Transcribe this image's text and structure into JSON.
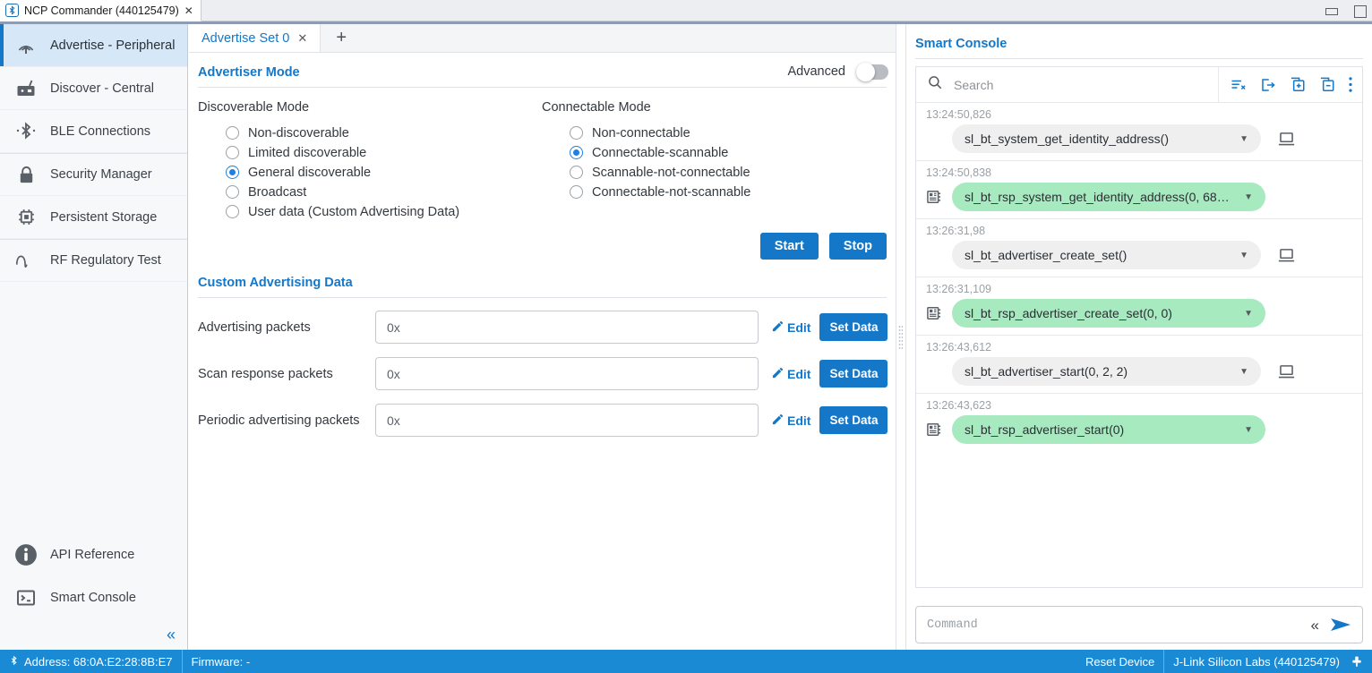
{
  "window": {
    "tab_title": "NCP Commander (440125479)",
    "app_icon": "bluetooth-icon",
    "tab_close_icon": "close-icon",
    "minimize_icon": "minimize-icon",
    "maximize_icon": "maximize-icon"
  },
  "sidebar": {
    "items": [
      {
        "label": "Advertise - Peripheral",
        "icon": "advertise-icon",
        "active": true
      },
      {
        "label": "Discover - Central",
        "icon": "radio-icon",
        "active": false
      },
      {
        "label": "BLE Connections",
        "icon": "bluetooth-connections-icon",
        "active": false
      },
      {
        "label": "Security Manager",
        "icon": "lock-icon",
        "active": false
      },
      {
        "label": "Persistent Storage",
        "icon": "chip-icon",
        "active": false
      },
      {
        "label": "RF Regulatory Test",
        "icon": "waveform-icon",
        "active": false
      }
    ],
    "bottom_items": [
      {
        "label": "API Reference",
        "icon": "info-icon"
      },
      {
        "label": "Smart Console",
        "icon": "terminal-icon"
      }
    ],
    "collapse_icon": "chevron-double-left-icon"
  },
  "center": {
    "tabs": [
      {
        "label": "Advertise Set 0",
        "close_icon": "close-icon",
        "active": true
      }
    ],
    "add_tab_icon": "plus-icon",
    "advertiser_mode": {
      "title": "Advertiser Mode",
      "advanced_label": "Advanced",
      "advanced_on": false,
      "discoverable": {
        "heading": "Discoverable Mode",
        "options": [
          {
            "label": "Non-discoverable",
            "selected": false
          },
          {
            "label": "Limited discoverable",
            "selected": false
          },
          {
            "label": "General discoverable",
            "selected": true
          },
          {
            "label": "Broadcast",
            "selected": false
          },
          {
            "label": "User data (Custom Advertising Data)",
            "selected": false
          }
        ]
      },
      "connectable": {
        "heading": "Connectable Mode",
        "options": [
          {
            "label": "Non-connectable",
            "selected": false
          },
          {
            "label": "Connectable-scannable",
            "selected": true
          },
          {
            "label": "Scannable-not-connectable",
            "selected": false
          },
          {
            "label": "Connectable-not-scannable",
            "selected": false
          }
        ]
      },
      "start_label": "Start",
      "stop_label": "Stop"
    },
    "custom_advertising_data": {
      "title": "Custom Advertising Data",
      "edit_label": "Edit",
      "edit_icon": "pencil-icon",
      "set_data_label": "Set Data",
      "rows": [
        {
          "label": "Advertising packets",
          "value": "0x"
        },
        {
          "label": "Scan response packets",
          "value": "0x"
        },
        {
          "label": "Periodic advertising packets",
          "value": "0x"
        }
      ]
    }
  },
  "smart_console": {
    "title": "Smart Console",
    "search_placeholder": "Search",
    "search_value": "",
    "search_icon": "search-icon",
    "tools": [
      {
        "name": "clear-list-icon"
      },
      {
        "name": "export-icon"
      },
      {
        "name": "expand-all-icon"
      },
      {
        "name": "collapse-all-icon"
      },
      {
        "name": "more-options-icon"
      }
    ],
    "entries": [
      {
        "time": "13:24:50,826",
        "text": "sl_bt_system_get_identity_address()",
        "kind": "request",
        "side_icon": "",
        "trailing_icon": "pc-icon"
      },
      {
        "time": "13:24:50,838",
        "text": "sl_bt_rsp_system_get_identity_address(0, 68:0A:...",
        "kind": "response",
        "side_icon": "chip-icon",
        "trailing_icon": ""
      },
      {
        "time": "13:26:31,98",
        "text": "sl_bt_advertiser_create_set()",
        "kind": "request",
        "side_icon": "",
        "trailing_icon": "pc-icon"
      },
      {
        "time": "13:26:31,109",
        "text": "sl_bt_rsp_advertiser_create_set(0, 0)",
        "kind": "response",
        "side_icon": "chip-icon",
        "trailing_icon": ""
      },
      {
        "time": "13:26:43,612",
        "text": "sl_bt_advertiser_start(0, 2, 2)",
        "kind": "request",
        "side_icon": "",
        "trailing_icon": "pc-icon"
      },
      {
        "time": "13:26:43,623",
        "text": "sl_bt_rsp_advertiser_start(0)",
        "kind": "response",
        "side_icon": "chip-icon",
        "trailing_icon": ""
      }
    ],
    "command_placeholder": "Command",
    "command_value": "",
    "prev_icon": "chevron-double-left-icon",
    "send_icon": "send-icon"
  },
  "statusbar": {
    "address_icon": "bluetooth-icon",
    "address": "Address: 68:0A:E2:28:8B:E7",
    "firmware": "Firmware: -",
    "reset_device": "Reset Device",
    "adapter": "J-Link Silicon Labs (440125479)",
    "adapter_icon": "usb-adapter-icon"
  },
  "colors": {
    "accent": "#1477c8",
    "status_bar": "#1a8ad4",
    "response_pill": "#a8eabf",
    "request_pill": "#efefef",
    "active_sidebar": "#d6e8f7"
  }
}
